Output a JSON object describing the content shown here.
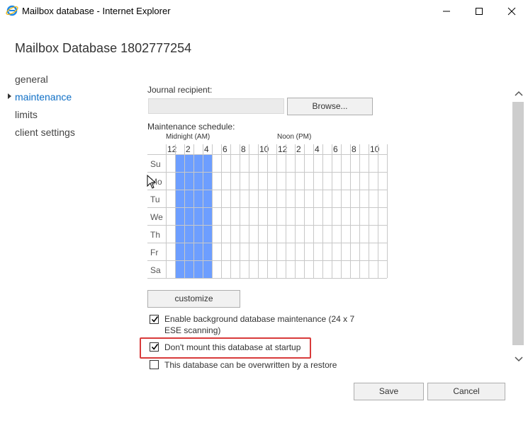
{
  "window": {
    "title": "Mailbox database - Internet Explorer"
  },
  "page": {
    "title": "Mailbox Database 1802777254"
  },
  "nav": {
    "items": [
      {
        "label": "general",
        "active": false
      },
      {
        "label": "maintenance",
        "active": true
      },
      {
        "label": "limits",
        "active": false
      },
      {
        "label": "client settings",
        "active": false
      }
    ]
  },
  "journal": {
    "label": "Journal recipient:",
    "value": "",
    "browse_label": "Browse..."
  },
  "schedule": {
    "label": "Maintenance schedule:",
    "midnight_label": "Midnight (AM)",
    "noon_label": "Noon (PM)",
    "hour_labels": [
      "12",
      "2",
      "4",
      "6",
      "8",
      "10",
      "12",
      "2",
      "4",
      "6",
      "8",
      "10"
    ],
    "days": [
      "Su",
      "Mo",
      "Tu",
      "We",
      "Th",
      "Fr",
      "Sa"
    ],
    "selected_hours": [
      1,
      2,
      3,
      4
    ],
    "selected_color": "#6d9eff",
    "customize_label": "customize"
  },
  "options": {
    "background_maintenance": {
      "label_line1": "Enable background database maintenance (24 x 7",
      "label_line2": "ESE scanning)",
      "checked": true
    },
    "dont_mount": {
      "label": "Don't mount this database at startup",
      "checked": true
    },
    "overwrite_restore": {
      "label": "This database can be overwritten by a restore",
      "checked": false
    }
  },
  "buttons": {
    "save": "Save",
    "cancel": "Cancel"
  },
  "colors": {
    "accent": "#0f6fc6",
    "highlight": "#d83b3b"
  }
}
